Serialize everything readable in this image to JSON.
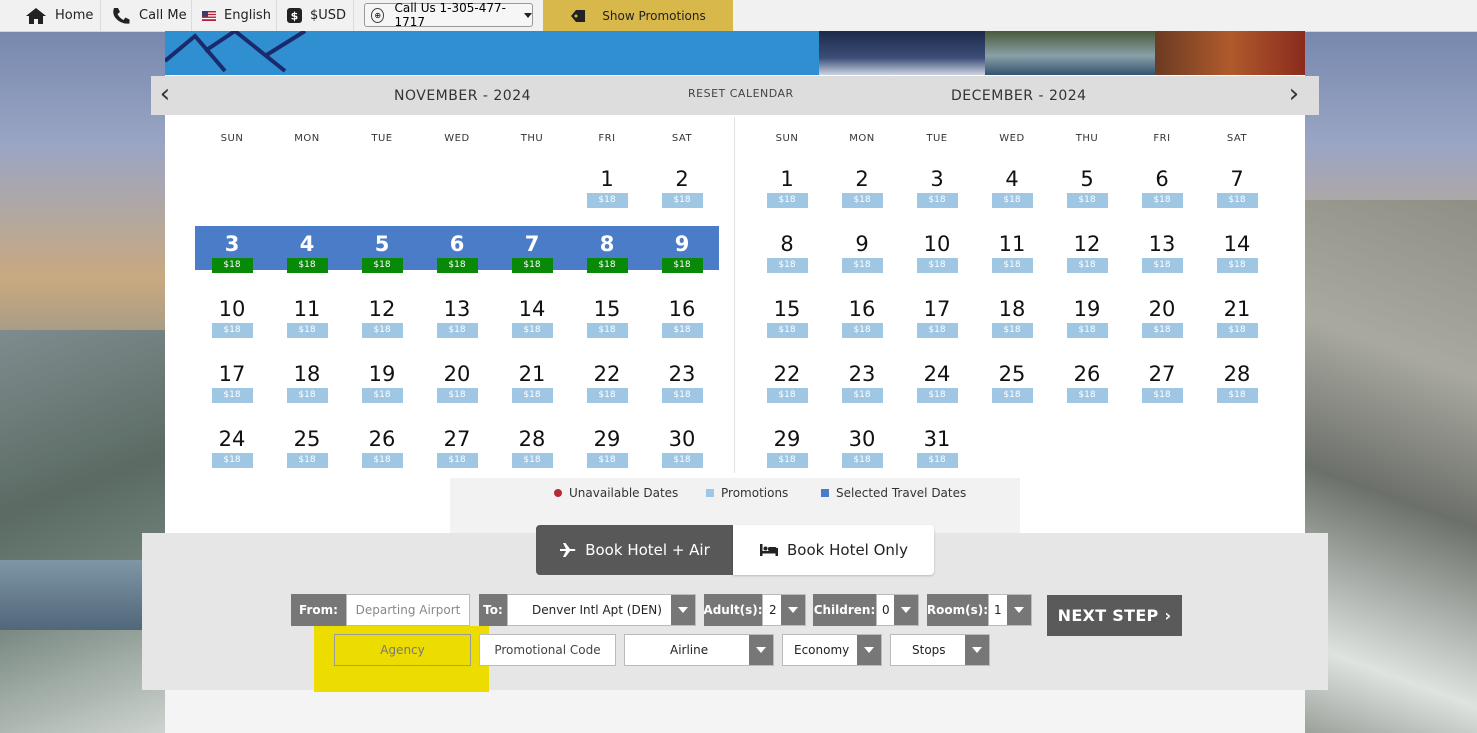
{
  "topbar": {
    "home": "Home",
    "call_me": "Call Me",
    "language": "English",
    "currency": "$USD",
    "call_us": "Call Us  1-305-477-1717",
    "show_promotions": "Show Promotions"
  },
  "calendar": {
    "reset": "RESET CALENDAR",
    "weekdays": [
      "SUN",
      "MON",
      "TUE",
      "WED",
      "THU",
      "FRI",
      "SAT"
    ],
    "months": [
      {
        "title": "NOVEMBER - 2024",
        "weeks": [
          [
            null,
            null,
            null,
            null,
            null,
            "1",
            "2"
          ],
          [
            "3",
            "4",
            "5",
            "6",
            "7",
            "8",
            "9"
          ],
          [
            "10",
            "11",
            "12",
            "13",
            "14",
            "15",
            "16"
          ],
          [
            "17",
            "18",
            "19",
            "20",
            "21",
            "22",
            "23"
          ],
          [
            "24",
            "25",
            "26",
            "27",
            "28",
            "29",
            "30"
          ]
        ]
      },
      {
        "title": "DECEMBER - 2024",
        "weeks": [
          [
            "1",
            "2",
            "3",
            "4",
            "5",
            "6",
            "7"
          ],
          [
            "8",
            "9",
            "10",
            "11",
            "12",
            "13",
            "14"
          ],
          [
            "15",
            "16",
            "17",
            "18",
            "19",
            "20",
            "21"
          ],
          [
            "22",
            "23",
            "24",
            "25",
            "26",
            "27",
            "28"
          ],
          [
            "29",
            "30",
            "31",
            null,
            null,
            null,
            null
          ]
        ]
      }
    ],
    "price": "$18",
    "selected_week_month": 0,
    "selected_week_index": 1
  },
  "legend": {
    "unavailable": "Unavailable Dates",
    "promotions": "Promotions",
    "selected": "Selected Travel Dates"
  },
  "colors": {
    "unavailable": "#b6293a",
    "promotions": "#9fc6e3",
    "selected": "#4a7cc7",
    "highlight": "#ecdc00"
  },
  "booking": {
    "mode_air": "Book Hotel + Air",
    "mode_hotel": "Book Hotel Only",
    "from_label": "From:",
    "from_placeholder": "Departing Airport",
    "to_label": "To:",
    "to_value": "Denver Intl Apt (DEN)",
    "adults_label": "Adult(s):",
    "adults_value": "2",
    "children_label": "Children:",
    "children_value": "0",
    "rooms_label": "Room(s):",
    "rooms_value": "1",
    "next_step": "NEXT STEP ›",
    "agency_placeholder": "Agency",
    "promo_code": "Promotional Code",
    "airline": "Airline",
    "cabin": "Economy",
    "stops": "Stops"
  }
}
